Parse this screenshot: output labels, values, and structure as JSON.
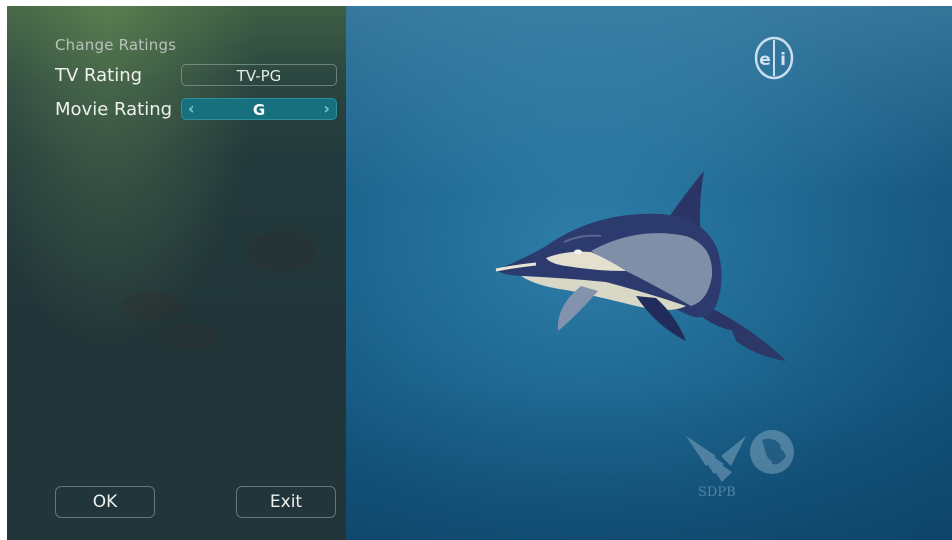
{
  "panel": {
    "title": "Change Ratings",
    "rows": [
      {
        "label": "TV Rating",
        "value": "TV-PG"
      },
      {
        "label": "Movie Rating",
        "value": "G"
      }
    ]
  },
  "buttons": {
    "ok": "OK",
    "exit": "Exit"
  },
  "video": {
    "logo_text": "ei",
    "watermark_text": "SDPB"
  },
  "icons": [
    "chevron-left-icon",
    "chevron-right-icon",
    "ei-logo-icon",
    "pbs-logo-icon"
  ],
  "colors": {
    "panel_bg": "#223639",
    "selected_field": "#17707e",
    "video_bg": "#1f6a94"
  }
}
